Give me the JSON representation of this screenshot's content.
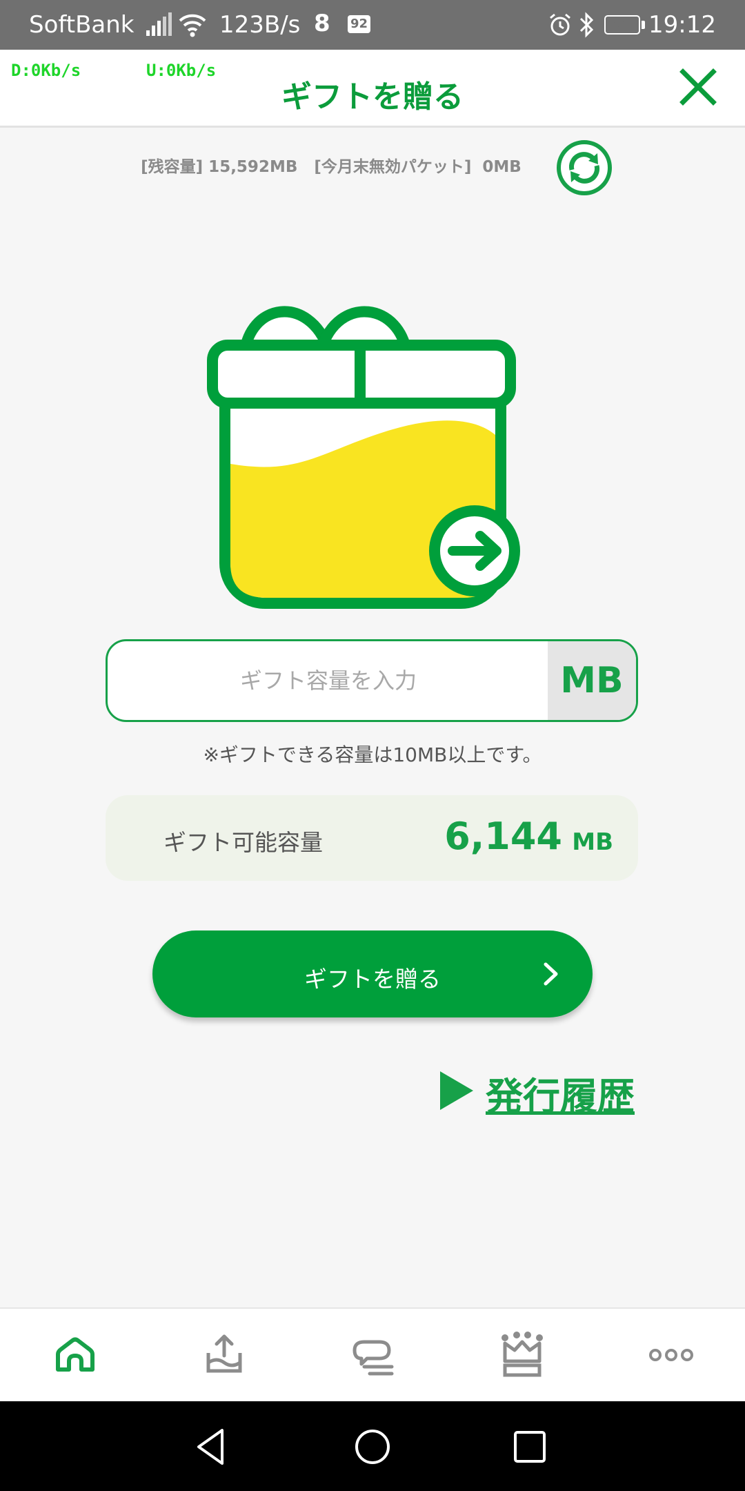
{
  "status_bar": {
    "carrier": "SoftBank",
    "speed": "123B/s",
    "badge": "8",
    "notification": "92",
    "battery": "92",
    "battery_level": 0.92,
    "time": "19:12"
  },
  "header": {
    "net_down": "D:0Kb/s",
    "net_up": "U:0Kb/s",
    "title": "ギフトを贈る"
  },
  "capacity_info": "[残容量] 15,592MB   [今月末無効パケット]  0MB",
  "input": {
    "placeholder": "ギフト容量を入力",
    "unit": "MB"
  },
  "note": "※ギフトできる容量は10MB以上です。",
  "available": {
    "label": "ギフト可能容量",
    "value": "6,144",
    "unit": "MB"
  },
  "send_button": {
    "label": "ギフトを贈る"
  },
  "history_link": {
    "label": "発行履歴"
  },
  "colors": {
    "brand_green": "#17a149",
    "button_green": "#009f3b",
    "gift_yellow": "#f9e421",
    "status_bar": "#707070"
  },
  "bottom_nav": [
    {
      "icon": "home-icon",
      "active": true
    },
    {
      "icon": "data-charge-icon",
      "active": false
    },
    {
      "icon": "chat-icon",
      "active": false
    },
    {
      "icon": "crown-icon",
      "active": false
    },
    {
      "icon": "more-icon",
      "active": false
    }
  ],
  "system_nav": [
    "back-icon",
    "home-circle-icon",
    "recents-icon"
  ]
}
